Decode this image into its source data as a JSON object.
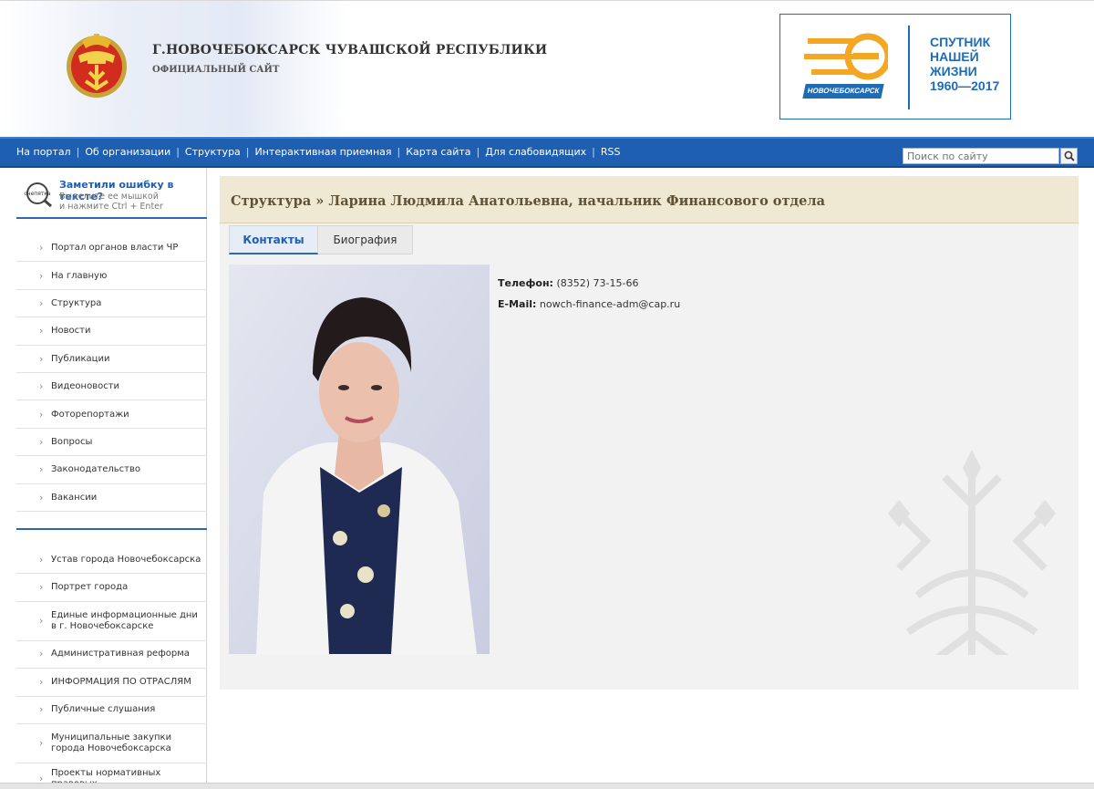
{
  "header": {
    "title": "Г.НОВОЧЕБОКСАРСК ЧУВАШСКОЙ РЕСПУБЛИКИ",
    "subtitle": "ОФИЦИАЛЬНЫЙ САЙТ",
    "banner": {
      "city": "НОВОЧЕБОКСАРСК",
      "line1": "СПУТНИК",
      "line2": "НАШЕЙ",
      "line3": "ЖИЗНИ",
      "line4": "1960—2017"
    }
  },
  "nav": {
    "items": [
      {
        "label": "На портал"
      },
      {
        "label": "Об организации"
      },
      {
        "label": "Структура"
      },
      {
        "label": "Интерактивная приемная"
      },
      {
        "label": "Карта сайта"
      },
      {
        "label": "Для слабовидящих"
      },
      {
        "label": "RSS"
      }
    ],
    "search_placeholder": "Поиск по сайту"
  },
  "typo": {
    "icon_text": "очепятка",
    "title": "Заметили ошибку в тексте?",
    "hint_line1": "Выделите ее мышкой",
    "hint_line2": "и нажмите Ctrl + Enter"
  },
  "sidebar": {
    "menu1": [
      "Портал органов власти ЧР",
      "На главную",
      "Структура",
      "Новости",
      "Публикации",
      "Видеоновости",
      "Фоторепортажи",
      "Вопросы",
      "Законодательство",
      "Вакансии"
    ],
    "menu2": [
      "Устав города Новочебоксарска",
      "Портрет города",
      "Единые информационные дни в г. Новочебоксарске",
      "Административная реформа",
      "ИНФОРМАЦИЯ ПО ОТРАСЛЯМ",
      "Публичные слушания",
      "Муниципальные закупки города Новочебоксарска",
      "Проекты нормативных правовых"
    ]
  },
  "main": {
    "heading": "Структура » Ларина Людмила Анатольевна, начальник Финансового отдела",
    "tabs": [
      {
        "label": "Контакты",
        "active": true
      },
      {
        "label": "Биография",
        "active": false
      }
    ],
    "contacts": {
      "phone_label": "Телефон:",
      "phone": "(8352) 73-15-66",
      "email_label": "E-Mail:",
      "email": "nowch-finance-adm@cap.ru"
    }
  },
  "colors": {
    "nav_blue": "#1f5fb2",
    "heading_bg": "#efe8d2",
    "heading_text": "#5f5236",
    "banner_blue": "#1f6cb5",
    "banner_orange": "#f5a623"
  }
}
